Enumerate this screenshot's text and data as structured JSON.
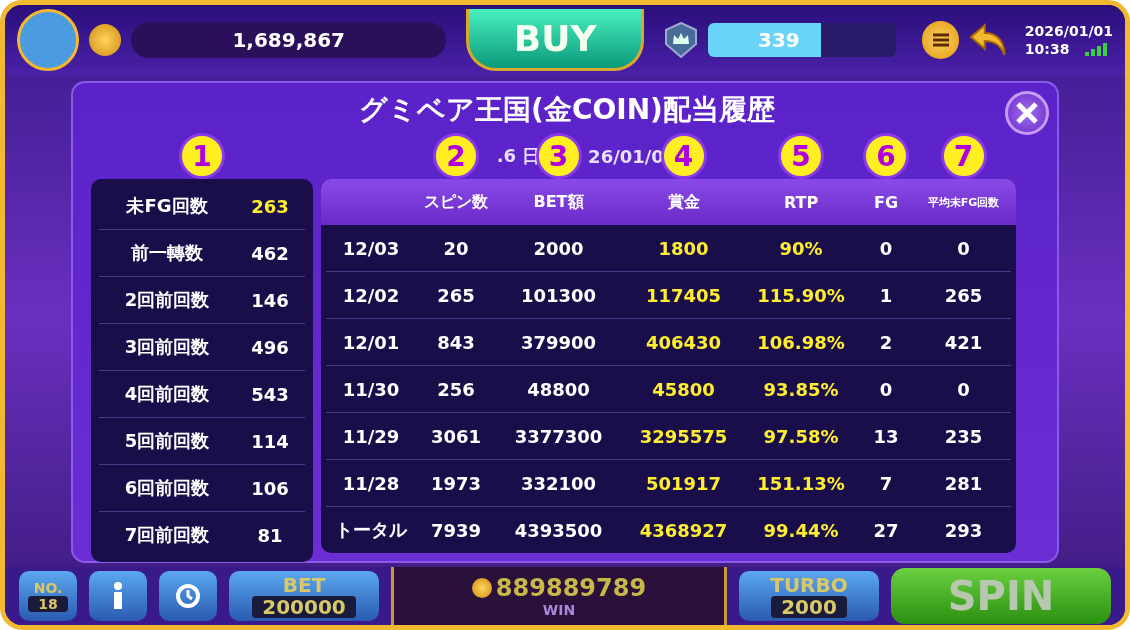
{
  "top_bar": {
    "coins": "1,689,867",
    "buy": "BUY",
    "level": "339",
    "date": "2026/01/01",
    "time": "10:38"
  },
  "dialog": {
    "title": "グミベア王国(金COIN)配当履歴",
    "subtitle_fragments": [
      ".6 日",
      "26/01/0"
    ],
    "badges": [
      "1",
      "2",
      "3",
      "4",
      "5",
      "6",
      "7"
    ],
    "summary": [
      {
        "label": "未FG回数",
        "value": "263",
        "highlight": true
      },
      {
        "label": "前一轉数",
        "value": "462",
        "highlight": false
      },
      {
        "label": "2回前回数",
        "value": "146",
        "highlight": false
      },
      {
        "label": "3回前回数",
        "value": "496",
        "highlight": false
      },
      {
        "label": "4回前回数",
        "value": "543",
        "highlight": false
      },
      {
        "label": "5回前回数",
        "value": "114",
        "highlight": false
      },
      {
        "label": "6回前回数",
        "value": "106",
        "highlight": false
      },
      {
        "label": "7回前回数",
        "value": "81",
        "highlight": false
      }
    ],
    "columns": [
      "",
      "スピン数",
      "BET額",
      "賞金",
      "RTP",
      "FG",
      "平均未FG回数"
    ],
    "rows": [
      [
        "12/03",
        "20",
        "2000",
        "1800",
        "90%",
        "0",
        "0"
      ],
      [
        "12/02",
        "265",
        "101300",
        "117405",
        "115.90%",
        "1",
        "265"
      ],
      [
        "12/01",
        "843",
        "379900",
        "406430",
        "106.98%",
        "2",
        "421"
      ],
      [
        "11/30",
        "256",
        "48800",
        "45800",
        "93.85%",
        "0",
        "0"
      ],
      [
        "11/29",
        "3061",
        "3377300",
        "3295575",
        "97.58%",
        "13",
        "235"
      ],
      [
        "11/28",
        "1973",
        "332100",
        "501917",
        "151.13%",
        "7",
        "281"
      ],
      [
        "トータル",
        "7939",
        "4393500",
        "4368927",
        "99.44%",
        "27",
        "293"
      ]
    ]
  },
  "bottom_bar": {
    "number_label": "NO.",
    "number": "18",
    "bet_label": "BET",
    "bet": "200000",
    "win_amount": "889889789",
    "win_label": "WIN",
    "turbo_label": "TURBO",
    "turbo": "2000",
    "spin": "SPIN"
  }
}
